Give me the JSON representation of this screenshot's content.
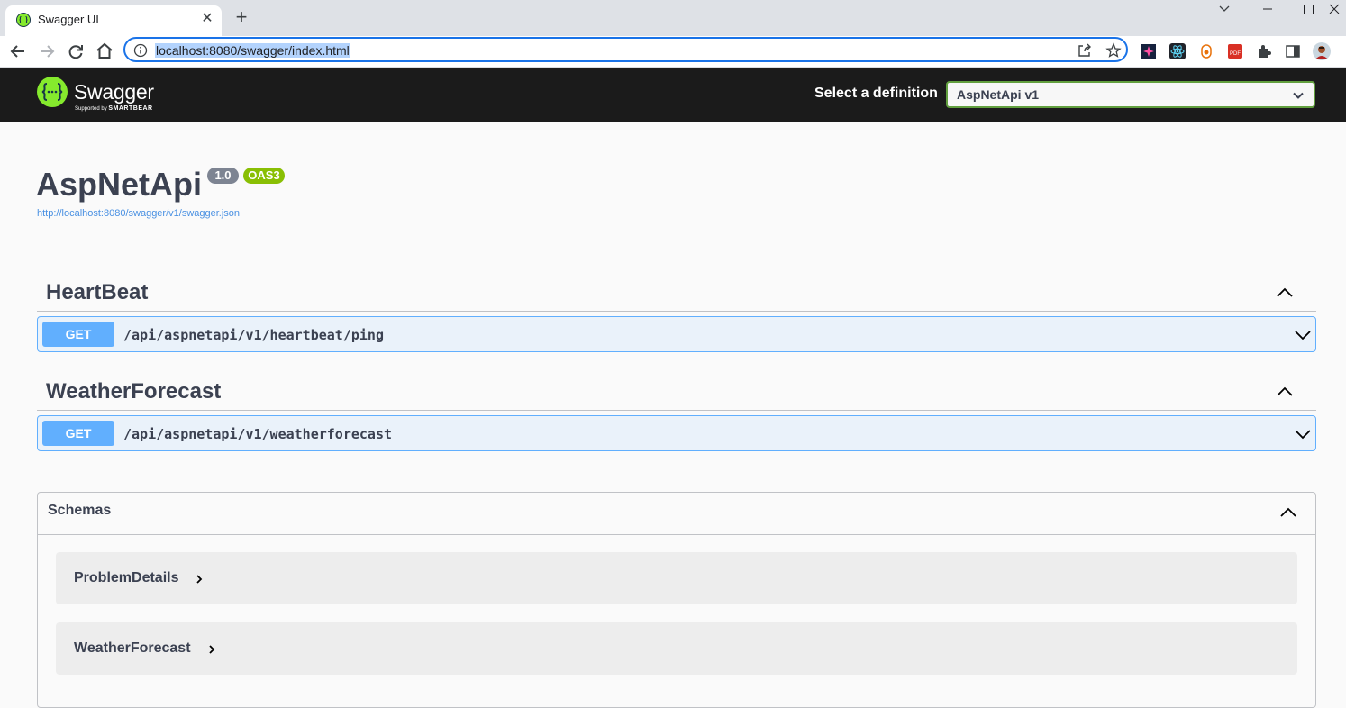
{
  "browser": {
    "tab_title": "Swagger UI",
    "url": "localhost:8080/swagger/index.html"
  },
  "topbar": {
    "logo_text": "Swagger",
    "logo_sub_prefix": "Supported by",
    "logo_sub_brand": "SMARTBEAR",
    "definition_label": "Select a definition",
    "definition_selected": "AspNetApi v1"
  },
  "info": {
    "title": "AspNetApi",
    "version": "1.0",
    "oas_badge": "OAS3",
    "spec_url": "http://localhost:8080/swagger/v1/swagger.json"
  },
  "tags": [
    {
      "name": "HeartBeat",
      "operations": [
        {
          "method": "GET",
          "path": "/api/aspnetapi/v1/heartbeat/ping"
        }
      ]
    },
    {
      "name": "WeatherForecast",
      "operations": [
        {
          "method": "GET",
          "path": "/api/aspnetapi/v1/weatherforecast"
        }
      ]
    }
  ],
  "schemas": {
    "title": "Schemas",
    "models": [
      "ProblemDetails",
      "WeatherForecast"
    ]
  },
  "colors": {
    "get_method": "#61affe",
    "oas_badge": "#89bf04",
    "topbar_bg": "#1b1b1b",
    "link": "#4990e2"
  }
}
